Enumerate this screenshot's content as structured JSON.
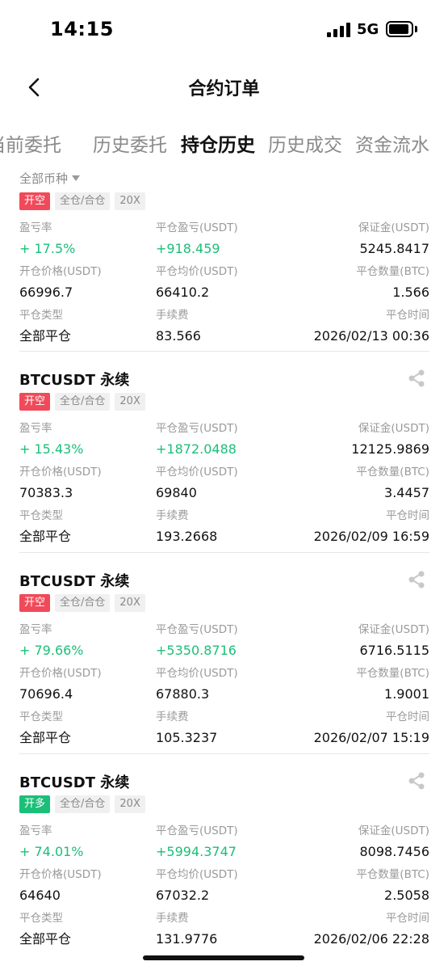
{
  "status": {
    "time": "14:15",
    "network": "5G"
  },
  "header": {
    "title": "合约订单"
  },
  "tabs": [
    {
      "label": "当前委托"
    },
    {
      "label": "历史委托"
    },
    {
      "label": "持仓历史"
    },
    {
      "label": "历史成交"
    },
    {
      "label": "资金流水"
    }
  ],
  "filter": {
    "label": "全部币种"
  },
  "labels": {
    "pnl_rate": "盈亏率",
    "close_pnl": "平仓盈亏(USDT)",
    "margin": "保证金(USDT)",
    "open_price": "开仓价格(USDT)",
    "close_avg": "平仓均价(USDT)",
    "close_qty": "平仓数量(BTC)",
    "close_type": "平仓类型",
    "fee": "手续费",
    "close_time": "平仓时间"
  },
  "colors": {
    "short": "#f04a5a",
    "long": "#1bbf78",
    "profit": "#1bbf78"
  },
  "orders": [
    {
      "title": "",
      "side": "开空",
      "mode": "全仓/合仓",
      "leverage": "20X",
      "pnl_rate": "+ 17.5%",
      "close_pnl": "+918.459",
      "margin": "5245.8417",
      "open_price": "66996.7",
      "close_avg": "66410.2",
      "close_qty": "1.566",
      "close_type": "全部平仓",
      "fee": "83.566",
      "close_time": "2026/02/13 00:36"
    },
    {
      "title": "BTCUSDT 永续",
      "side": "开空",
      "mode": "全仓/合仓",
      "leverage": "20X",
      "pnl_rate": "+ 15.43%",
      "close_pnl": "+1872.0488",
      "margin": "12125.9869",
      "open_price": "70383.3",
      "close_avg": "69840",
      "close_qty": "3.4457",
      "close_type": "全部平仓",
      "fee": "193.2668",
      "close_time": "2026/02/09 16:59"
    },
    {
      "title": "BTCUSDT 永续",
      "side": "开空",
      "mode": "全仓/合仓",
      "leverage": "20X",
      "pnl_rate": "+ 79.66%",
      "close_pnl": "+5350.8716",
      "margin": "6716.5115",
      "open_price": "70696.4",
      "close_avg": "67880.3",
      "close_qty": "1.9001",
      "close_type": "全部平仓",
      "fee": "105.3237",
      "close_time": "2026/02/07 15:19"
    },
    {
      "title": "BTCUSDT 永续",
      "side": "开多",
      "mode": "全仓/合仓",
      "leverage": "20X",
      "pnl_rate": "+ 74.01%",
      "close_pnl": "+5994.3747",
      "margin": "8098.7456",
      "open_price": "64640",
      "close_avg": "67032.2",
      "close_qty": "2.5058",
      "close_type": "全部平仓",
      "fee": "131.9776",
      "close_time": "2026/02/06 22:28"
    }
  ]
}
